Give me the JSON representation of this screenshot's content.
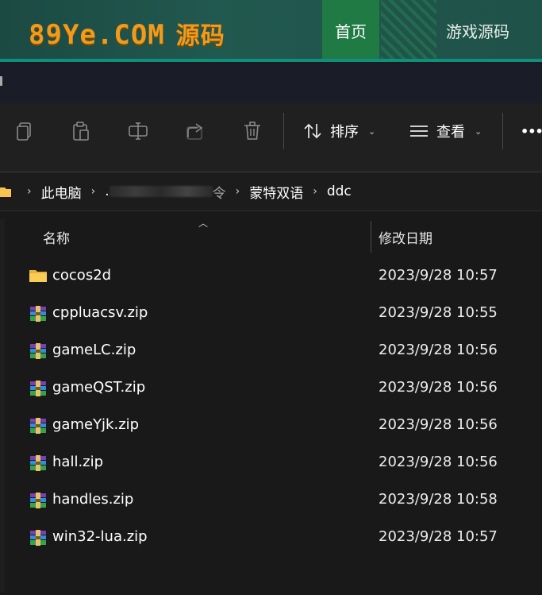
{
  "banner": {
    "logo_text": "89Ye.COM",
    "logo_cn": "源码",
    "nav_home": "首页",
    "nav_games": "游戏源码",
    "colors": {
      "bg": "#21584f",
      "logo": "#f29a1c",
      "active": "#1f7a44"
    }
  },
  "toolbar": {
    "icons": [
      "copy-icon",
      "paste-icon",
      "rename-icon",
      "share-icon",
      "delete-icon"
    ],
    "sort_label": "排序",
    "view_label": "查看",
    "more_label": "•••"
  },
  "address": {
    "root": "此电脑",
    "obscured_prefix": ".",
    "obscured_suffix": "令",
    "folder1": "蒙特双语",
    "folder2": "ddc"
  },
  "columns": {
    "name": "名称",
    "date": "修改日期"
  },
  "files": [
    {
      "name": "cocos2d",
      "date": "2023/9/28 10:57",
      "icon": "folder-icon"
    },
    {
      "name": "cppluacsv.zip",
      "date": "2023/9/28 10:55",
      "icon": "winrar-archive-icon"
    },
    {
      "name": "gameLC.zip",
      "date": "2023/9/28 10:56",
      "icon": "winrar-archive-icon"
    },
    {
      "name": "gameQST.zip",
      "date": "2023/9/28 10:56",
      "icon": "winrar-archive-icon"
    },
    {
      "name": "gameYjk.zip",
      "date": "2023/9/28 10:56",
      "icon": "winrar-archive-icon"
    },
    {
      "name": "hall.zip",
      "date": "2023/9/28 10:56",
      "icon": "winrar-archive-icon"
    },
    {
      "name": "handles.zip",
      "date": "2023/9/28 10:58",
      "icon": "winrar-archive-icon"
    },
    {
      "name": "win32-lua.zip",
      "date": "2023/9/28 10:57",
      "icon": "winrar-archive-icon"
    }
  ]
}
